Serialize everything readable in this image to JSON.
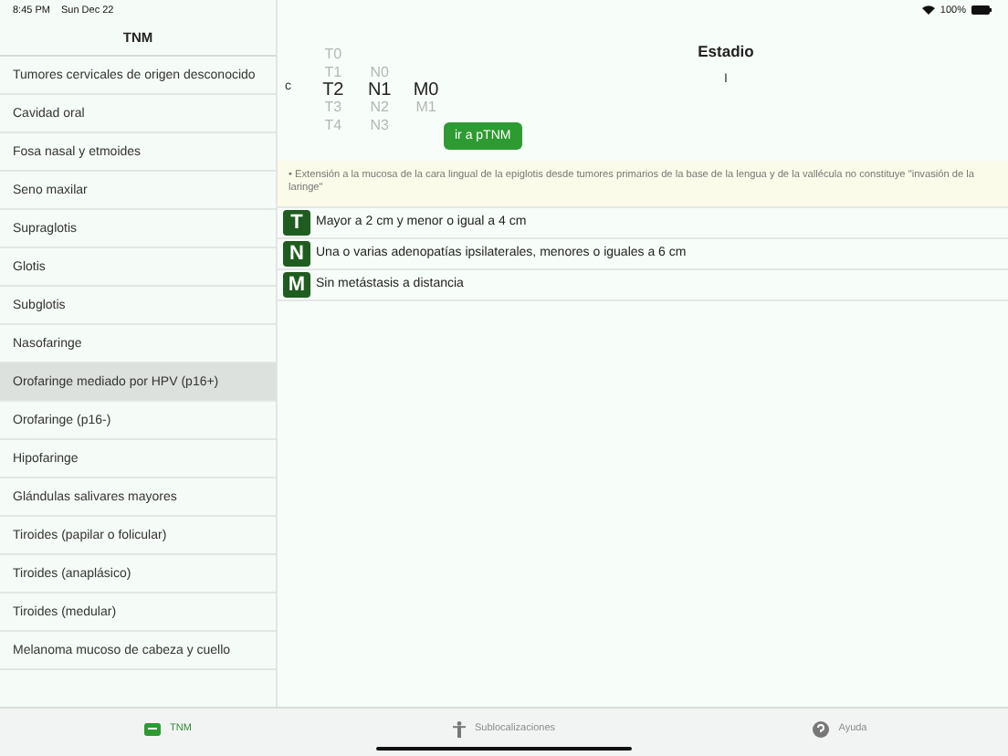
{
  "status_bar": {
    "time": "8:45 PM",
    "date": "Sun Dec 22",
    "battery": "100%"
  },
  "sidebar": {
    "title": "TNM",
    "items": [
      {
        "label": "Tumores cervicales de origen desconocido",
        "selected": false
      },
      {
        "label": "Cavidad oral",
        "selected": false
      },
      {
        "label": "Fosa nasal y etmoides",
        "selected": false
      },
      {
        "label": "Seno maxilar",
        "selected": false
      },
      {
        "label": "Supraglotis",
        "selected": false
      },
      {
        "label": "Glotis",
        "selected": false
      },
      {
        "label": "Subglotis",
        "selected": false
      },
      {
        "label": "Nasofaringe",
        "selected": false
      },
      {
        "label": "Orofaringe mediado por HPV (p16+)",
        "selected": true
      },
      {
        "label": "Orofaringe (p16-)",
        "selected": false
      },
      {
        "label": "Hipofaringe",
        "selected": false
      },
      {
        "label": "Glándulas salivares mayores",
        "selected": false
      },
      {
        "label": "Tiroides (papilar o folicular)",
        "selected": false
      },
      {
        "label": "Tiroides (anaplásico)",
        "selected": false
      },
      {
        "label": "Tiroides (medular)",
        "selected": false
      },
      {
        "label": "Melanoma mucoso de cabeza y cuello",
        "selected": false
      }
    ]
  },
  "picker": {
    "prefix": "c",
    "columns": [
      {
        "options": [
          {
            "label": "T0",
            "selected": false
          },
          {
            "label": "T1",
            "selected": false
          },
          {
            "label": "T2",
            "selected": true
          },
          {
            "label": "T3",
            "selected": false
          },
          {
            "label": "T4",
            "selected": false
          }
        ]
      },
      {
        "options": [
          {
            "label": "N0",
            "selected": false
          },
          {
            "label": "N1",
            "selected": true
          },
          {
            "label": "N2",
            "selected": false
          },
          {
            "label": "N3",
            "selected": false
          }
        ]
      },
      {
        "options": [
          {
            "label": "M0",
            "selected": true
          },
          {
            "label": "M1",
            "selected": false
          }
        ]
      }
    ]
  },
  "stage": {
    "title": "Estadio",
    "value": "I"
  },
  "button": "ir a pTNM",
  "note": "• Extensión a la mucosa de la cara lingual de la epiglotis desde tumores primarios de la base de la lengua y de la vallécula no constituye \"invasión de la laringe\"",
  "descriptors": [
    {
      "letter": "T",
      "text": "Mayor a 2 cm y menor o igual a 4 cm"
    },
    {
      "letter": "N",
      "text": "Una o varias adenopatías ipsilaterales, menores o iguales a 6 cm"
    },
    {
      "letter": "M",
      "text": "Sin metástasis a distancia"
    }
  ],
  "tab_bar": [
    {
      "kind": "tnm",
      "label": "TNM",
      "selected": true
    },
    {
      "kind": "figure",
      "label": "Sublocalizaciones",
      "selected": false
    },
    {
      "kind": "help",
      "label": "Ayuda",
      "selected": false
    }
  ]
}
